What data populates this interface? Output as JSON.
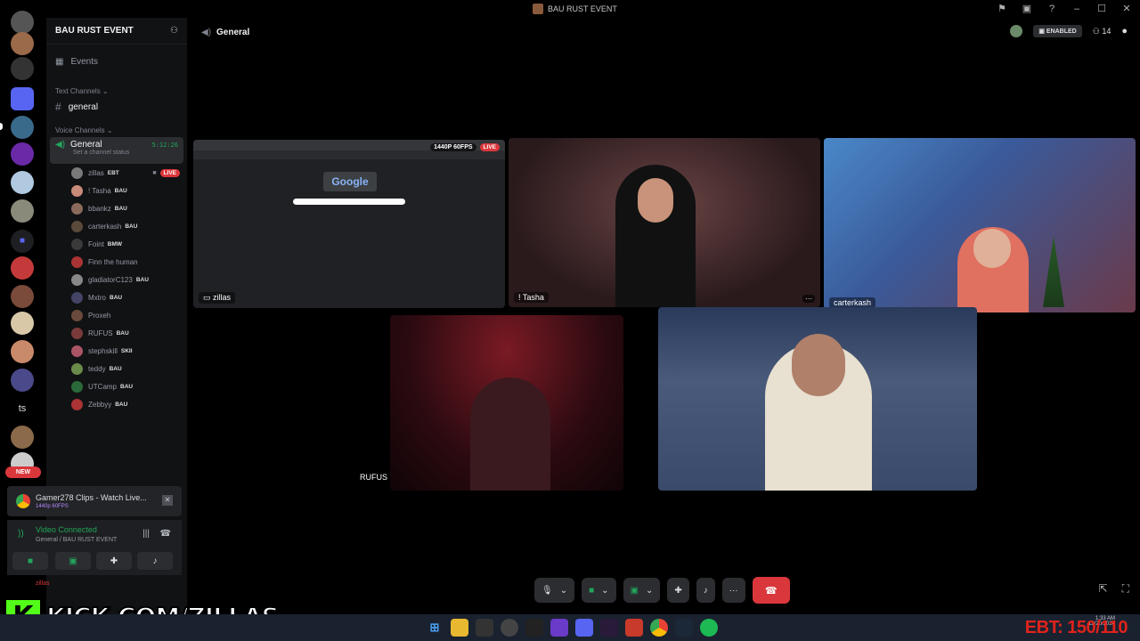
{
  "window": {
    "title": "BAU RUST EVENT"
  },
  "guild": {
    "name": "BAU RUST EVENT"
  },
  "sidebar": {
    "events_label": "Events",
    "text_category": "Text Channels",
    "text_channels": [
      "general"
    ],
    "voice_category": "Voice Channels",
    "voice_channel": {
      "name": "General",
      "status_placeholder": "Set a channel status",
      "time": "5:12:26"
    },
    "voice_users": [
      {
        "name": "zillas",
        "tag": "EBT",
        "live": "LIVE",
        "color": "#7a7a7a"
      },
      {
        "name": "! Tasha",
        "tag": "BAU",
        "color": "#c98a7a"
      },
      {
        "name": "bbankz",
        "tag": "BAU",
        "color": "#8a6a5a"
      },
      {
        "name": "carterkash",
        "tag": "BAU",
        "color": "#5a4a3a"
      },
      {
        "name": "Foint",
        "tag": "BMW",
        "color": "#3a3a3a"
      },
      {
        "name": "Finn the human",
        "tag": "",
        "color": "#a33"
      },
      {
        "name": "gladiatorC123",
        "tag": "BAU",
        "color": "#888"
      },
      {
        "name": "Mxtro",
        "tag": "BAU",
        "color": "#446"
      },
      {
        "name": "Proxeh",
        "tag": "",
        "color": "#6a4a3a"
      },
      {
        "name": "RUFUS",
        "tag": "BAU",
        "color": "#7a3a3a"
      },
      {
        "name": "stephskill",
        "tag": "SKII",
        "color": "#a56"
      },
      {
        "name": "teddy",
        "tag": "BAU",
        "color": "#6a8a4a"
      },
      {
        "name": "UTCamp",
        "tag": "BAU",
        "color": "#2a6a3a"
      },
      {
        "name": "Zebbyy",
        "tag": "BAU",
        "color": "#a33"
      }
    ]
  },
  "activity": {
    "title": "Gamer278 Clips - Watch Live...",
    "sub": "1440p 60FPS"
  },
  "voice_connection": {
    "status": "Video Connected",
    "location": "General / BAU RUST EVENT"
  },
  "user_bar": {
    "name": "zillas"
  },
  "topbar": {
    "channel": "General",
    "enabled_label": "ENABLED",
    "member_count": "14"
  },
  "tiles": {
    "zillas": {
      "label": "zillas",
      "resolution": "1440P 60FPS",
      "live": "LIVE",
      "google_text": "Google"
    },
    "tasha": {
      "label": "! Tasha"
    },
    "carterkash": {
      "label": "carterkash"
    },
    "rufus": {
      "label": "RUFUS"
    }
  },
  "banner": {
    "kick_letter": "K",
    "kick_text": "KICK.COM/ZILLAS",
    "new_badge": "NEW",
    "rail_text": "ts"
  },
  "overlay": {
    "ebt": "EBT: 150/110",
    "time": "1:33 AM",
    "date": "12/20/2024"
  },
  "colors": {
    "accent_green": "#23a55a",
    "danger": "#da373c",
    "kick_green": "#53fc18"
  }
}
